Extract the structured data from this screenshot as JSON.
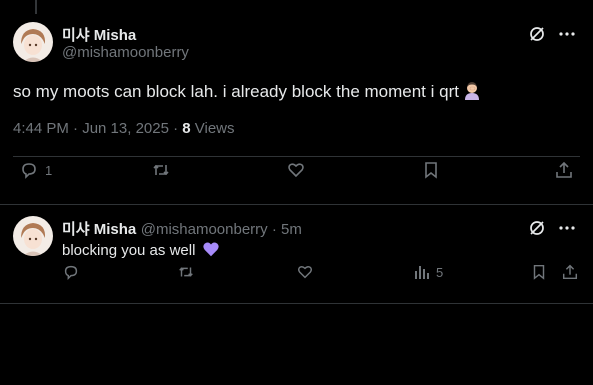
{
  "main_tweet": {
    "author_name": "미샤 Misha",
    "author_handle": "@mishamoonberry",
    "text": "so my moots can block lah. i already block the moment i qrt",
    "time": "4:44 PM · Jun 13, 2025 · ",
    "views_count": "8",
    "views_label": " Views",
    "reply_count": "1",
    "icons": {
      "grok": "grok-icon",
      "more": "more-icon",
      "reply": "reply-icon",
      "retweet": "retweet-icon",
      "like": "like-icon",
      "bookmark": "bookmark-icon",
      "share": "share-icon",
      "emoji": "person-facepalming-emoji"
    }
  },
  "reply_tweet": {
    "author_name": "미샤 Misha",
    "author_handle": "@mishamoonberry",
    "separator": " · ",
    "age": "5m",
    "text": "blocking you as well",
    "views_count": "5",
    "icons": {
      "emoji": "purple-heart-emoji",
      "views": "analytics-icon"
    }
  },
  "colors": {
    "background": "#000000",
    "text": "#e7e9ea",
    "muted": "#71767b",
    "divider": "#2f3336"
  }
}
